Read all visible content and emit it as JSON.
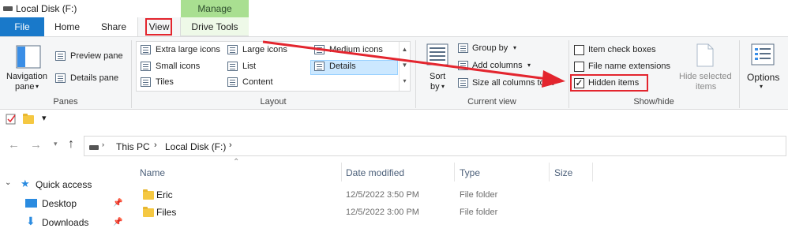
{
  "window": {
    "title": "Local Disk (F:)"
  },
  "contextual": {
    "label": "Manage"
  },
  "tabs": {
    "file": "File",
    "home": "Home",
    "share": "Share",
    "view": "View",
    "drive_tools": "Drive Tools"
  },
  "ribbon": {
    "panes": {
      "navigation_pane": "Navigation",
      "navigation_pane_2": "pane",
      "preview_pane": "Preview pane",
      "details_pane": "Details pane",
      "label": "Panes"
    },
    "layout": {
      "extra_large_icons": "Extra large icons",
      "large_icons": "Large icons",
      "medium_icons": "Medium icons",
      "small_icons": "Small icons",
      "list": "List",
      "details": "Details",
      "tiles": "Tiles",
      "content": "Content",
      "label": "Layout"
    },
    "current_view": {
      "sort_by": "Sort",
      "sort_by_2": "by",
      "group_by": "Group by",
      "add_columns": "Add columns",
      "size_all_columns": "Size all columns to fit",
      "label": "Current view"
    },
    "show_hide": {
      "item_check_boxes": "Item check boxes",
      "file_name_extensions": "File name extensions",
      "hidden_items": "Hidden items",
      "hide_selected": "Hide selected",
      "hide_selected_2": "items",
      "label": "Show/hide",
      "item_check_boxes_checked": false,
      "file_name_extensions_checked": false,
      "hidden_items_checked": true
    },
    "options": {
      "label": "Options"
    }
  },
  "breadcrumb": {
    "root": "This PC",
    "current": "Local Disk (F:)"
  },
  "nav_pane": {
    "quick_access": "Quick access",
    "items": [
      {
        "label": "Desktop"
      },
      {
        "label": "Downloads"
      }
    ]
  },
  "columns": {
    "name": "Name",
    "date_modified": "Date modified",
    "type": "Type",
    "size": "Size"
  },
  "files": [
    {
      "name": "Eric",
      "date": "12/5/2022 3:50 PM",
      "type": "File folder"
    },
    {
      "name": "Files",
      "date": "12/5/2022 3:00 PM",
      "type": "File folder"
    }
  ],
  "colors": {
    "file_tab": "#1979ca",
    "manage_green": "#a9df91",
    "highlight_red": "#e3252e",
    "selected_blue": "#cce8ff"
  }
}
